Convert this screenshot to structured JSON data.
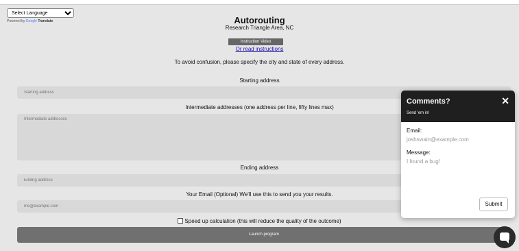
{
  "language_selector": {
    "label": "Select Language"
  },
  "powered_by": {
    "prefix": "Powered by",
    "google": "Google",
    "translate": "Translate"
  },
  "header": {
    "title": "Autorouting",
    "subtitle": "Research Triangle Area, NC"
  },
  "instruction_video_label": "Instruction Video",
  "read_instructions_link": "Or read instructions",
  "note": "To avoid confusion, please specify the city and state of every address.",
  "starting": {
    "label": "Starting address",
    "placeholder": "Starting address"
  },
  "intermediate": {
    "label": "Intermediate addresses (one address per line, fifty lines max)",
    "placeholder": "Intermediate addresses"
  },
  "ending": {
    "label": "Ending address",
    "placeholder": "Ending address"
  },
  "email": {
    "label": "Your Email (Optional) We'll use this to send you your results.",
    "placeholder": "me@example.com"
  },
  "speedup_label": "Speed up calculation (this will reduce the quality of the outcome)",
  "launch_label": "Launch program",
  "comments": {
    "title": "Comments?",
    "subtitle": "Send 'em in!",
    "close_glyph": "✕",
    "email_label": "Email:",
    "email_placeholder": "joshswain@example.com",
    "message_label": "Message:",
    "message_placeholder": "I found a bug!",
    "submit_label": "Submit"
  },
  "icons": {
    "chat": "chat-bubble-icon",
    "close": "close-icon",
    "dropdown": "chevron-down-icon"
  }
}
